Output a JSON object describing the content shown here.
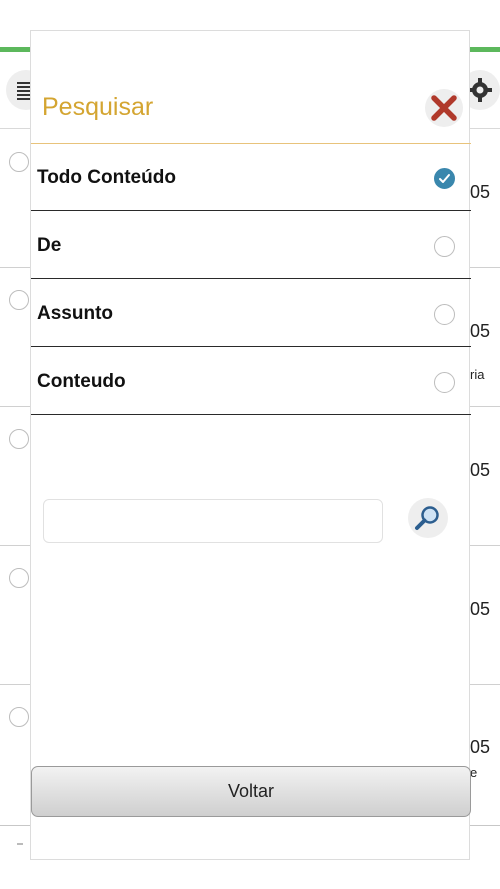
{
  "modal": {
    "title": "Pesquisar",
    "options": [
      {
        "label": "Todo Conteúdo",
        "selected": true
      },
      {
        "label": "De",
        "selected": false
      },
      {
        "label": "Assunto",
        "selected": false
      },
      {
        "label": "Conteudo",
        "selected": false
      }
    ],
    "search": {
      "value": "",
      "placeholder": ""
    },
    "back_label": "Voltar"
  },
  "background": {
    "rows": [
      {
        "date": "05",
        "snippet": ""
      },
      {
        "date": "05",
        "snippet": "ria"
      },
      {
        "date": "05",
        "snippet": ""
      },
      {
        "date": "05",
        "snippet": ""
      },
      {
        "date": "05",
        "snippet": "e"
      }
    ]
  },
  "colors": {
    "title": "#d4a531",
    "checked": "#3a87ad",
    "close_x": "#b0392b",
    "top_bar": "#5cb85c"
  },
  "icons": {
    "menu": "menu-list-icon",
    "settings": "gear-icon",
    "close": "close-icon",
    "search": "magnifier-icon",
    "check": "check-icon"
  }
}
